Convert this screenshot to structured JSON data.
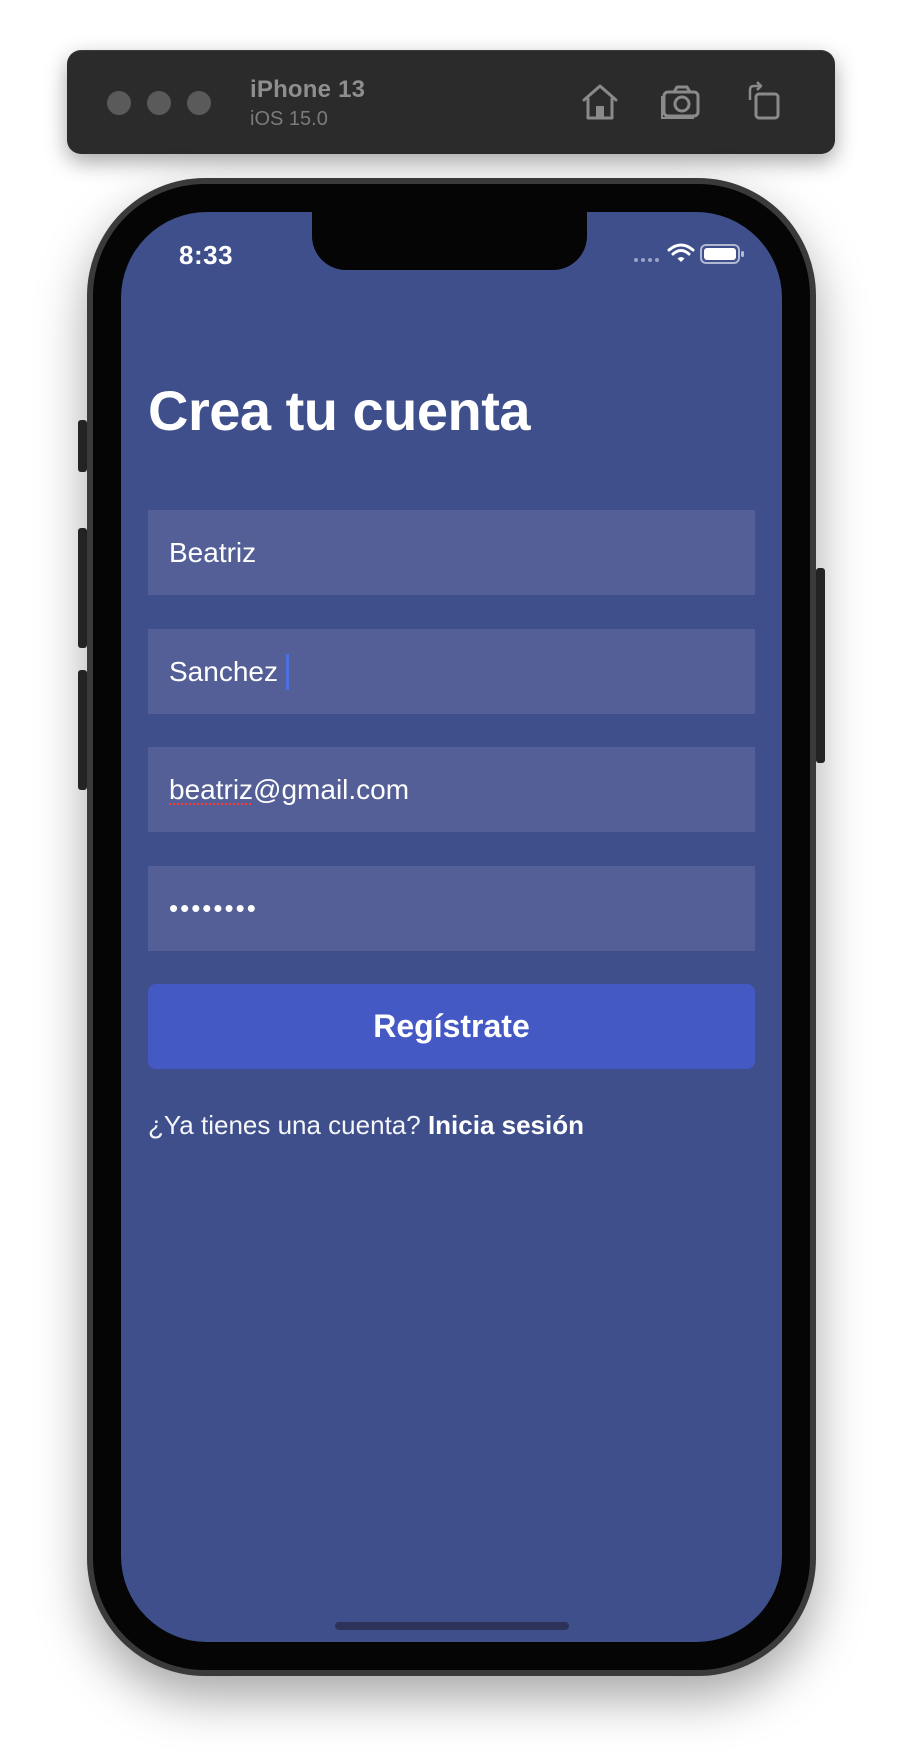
{
  "simulator": {
    "device_name": "iPhone 13",
    "os_version": "iOS 15.0",
    "icons": [
      "home-icon",
      "screenshot-icon",
      "rotate-icon"
    ]
  },
  "status_bar": {
    "time": "8:33",
    "icons": [
      "cellular-icon",
      "wifi-icon",
      "battery-icon"
    ]
  },
  "screen": {
    "title": "Crea tu cuenta",
    "fields": {
      "first_name": "Beatriz",
      "last_name": "Sanchez",
      "email_user": "beatriz",
      "email_domain": "@gmail.com",
      "password_masked": "••••••••"
    },
    "register_label": "Regístrate",
    "login_prompt": "¿Ya tienes una cuenta? ",
    "login_link": "Inicia sesión"
  },
  "colors": {
    "background": "#3f4f8c",
    "field_bg": "#535f96",
    "button_bg": "#4459c3",
    "caret": "#4d6fe0",
    "text": "#ffffff"
  }
}
